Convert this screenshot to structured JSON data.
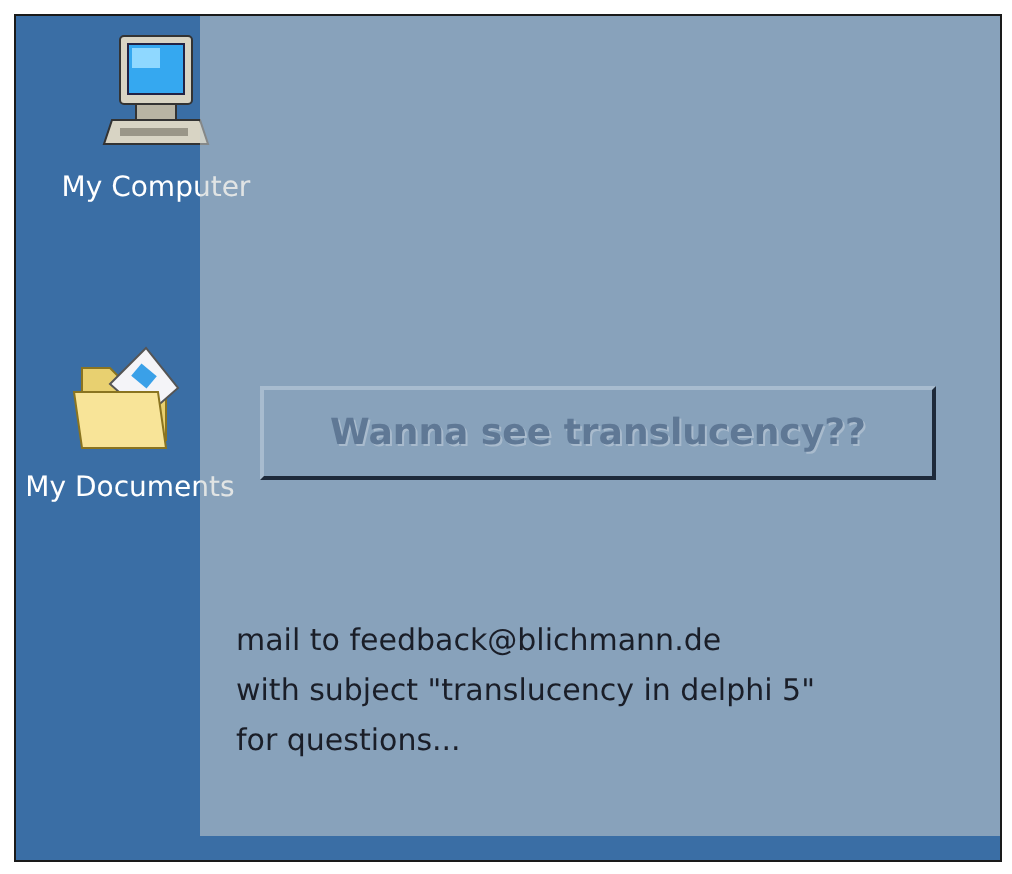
{
  "desktop_icons": [
    {
      "kind": "computer",
      "label": "My Computer"
    },
    {
      "kind": "folder",
      "label": "My Documents"
    }
  ],
  "window": {
    "button": "Wanna see translucency??",
    "message": "mail to feedback@blichmann.de\nwith subject \"translucency in delphi 5\"\nfor questions..."
  }
}
